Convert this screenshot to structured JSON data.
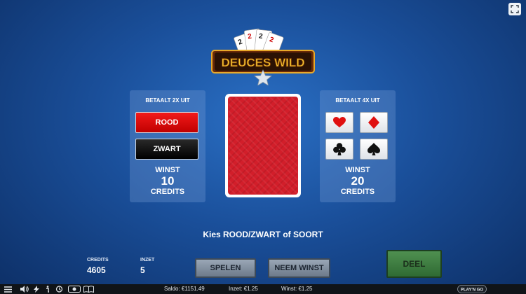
{
  "logo": {
    "text": "DEUCES WILD",
    "card_text": "2"
  },
  "left_panel": {
    "title": "BETAALT 2X UIT",
    "red_label": "ROOD",
    "black_label": "ZWART",
    "win_label": "WINST",
    "win_value": "10",
    "win_unit": "CREDITS"
  },
  "right_panel": {
    "title": "BETAALT 4X UIT",
    "suits": [
      "heart-icon",
      "diamond-icon",
      "club-icon",
      "spade-icon"
    ],
    "win_label": "WINST",
    "win_value": "20",
    "win_unit": "CREDITS"
  },
  "instruction": "Kies ROOD/ZWART of SOORT",
  "stats": {
    "credits_label": "CREDITS",
    "credits_value": "4605",
    "inzet_label": "INZET",
    "inzet_value": "5"
  },
  "actions": {
    "spelen": "SPELEN",
    "neem_winst": "NEEM WINST",
    "deel": "DEEL"
  },
  "bottom_bar": {
    "saldo": "Saldo: €1151.49",
    "inzet": "Inzet: €1.25",
    "winst": "Winst: €1.25",
    "provider": "PLAY'N GO"
  },
  "colors": {
    "background": "#1a4f9a",
    "red_button": "#e00000",
    "card_back": "#d21e2a",
    "deel_button": "#3f7d42"
  }
}
